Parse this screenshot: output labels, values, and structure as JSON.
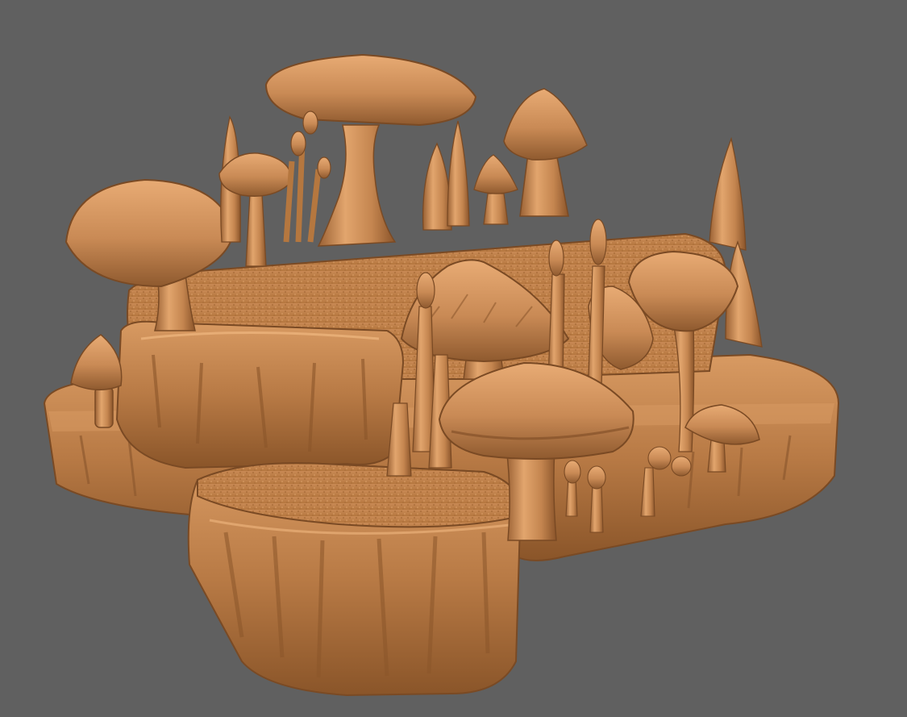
{
  "viewport": {
    "background_color": "#606060",
    "model_color": "#c98a55",
    "shadow_color": "#7a4a24",
    "highlight_color": "#f2c08a"
  }
}
